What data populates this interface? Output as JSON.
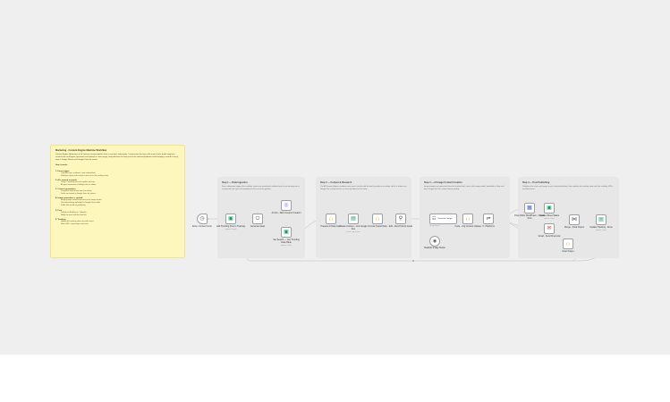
{
  "colors": {
    "canvas": "#efefef",
    "sticky": "#fdf6bd",
    "section": "#e7e7e7",
    "node_border": "#9aa0a6",
    "wire": "#b9b9b9"
  },
  "sticky": {
    "title": "Marketing · Content Engine Machine Workflow",
    "intro": "Content Engine. Automates a full content creation pipeline from a new topic submission. It researches the topic with search tools, drafts long-form content with an AI agent, generates and uploads a cover image, and publishes the final post to the selected platforms while keeping a record of every step in Google Sheets and Google Drive for review.",
    "heading": "How it works",
    "steps": [
      {
        "title": "1. Form trigger",
        "items": [
          "Captures topic, audience, tone and platform",
          "Validates inputs and creates a new row in the tracking sheet"
        ]
      },
      {
        "title": "2. AI + search research",
        "items": [
          "Tavily / Perplexity search to gather sources",
          "AI agent summarizes findings into an outline"
        ]
      },
      {
        "title": "3. Content generation",
        "items": [
          "Long-form draft written from the outline",
          "Drafts are saved as Google Docs for review"
        ]
      },
      {
        "title": "4. Image generation + upload",
        "items": [
          "Image prompt created and sent to the image model",
          "Generated image uploaded to Google Drive folder",
          "Public link stored for publishing"
        ]
      },
      {
        "title": "5. Post",
        "items": [
          "Publish to WordPress / LinkedIn",
          "Notify the team with the final link"
        ]
      },
      {
        "title": "6. Tracking",
        "items": [
          "Update the tracking sheet row with status",
          "Store URLs, timestamps and costs"
        ]
      }
    ]
  },
  "sections": [
    {
      "title": "Step 1 — Data Ingestion",
      "desc": "Form submission triggers the workflow. Inputs are normalised, validated and a new tracking row is created with the topic and metadata for the rest of the pipeline."
    },
    {
      "title": "Step 2 — Content & Research",
      "desc": "The AI Research Agent combines web search results with the brief to produce an outline, which is written to a Google Doc and passed on as structured data for the writer."
    },
    {
      "title": "Step 3 — AI Image Content Creation",
      "desc": "Image prompts are generated from the finished draft, sent to the image model, uploaded to Drive and then merged with the content before posting."
    },
    {
      "title": "Step 4 — Post Publishing",
      "desc": "Publishes the article and image to each selected platform, then updates the tracking sheet with the resulting URLs and final status."
    }
  ],
  "nodes": {
    "trigger": {
      "label": "Enter: Content Form",
      "icon": "◷"
    },
    "sheet_add": {
      "label": "Add Trending Post to Tracking",
      "sub": "append: sheet",
      "icon": "▣"
    },
    "generate": {
      "label": "Generate ideas",
      "icon": "⏻"
    },
    "research_ai": {
      "label": "AI Info - SEO Content Creation",
      "icon": "◎"
    },
    "set_row": {
      "label": "Set Search — Get Trending Data Table",
      "sub": "update: sheet",
      "icon": "▣"
    },
    "code_prepare": {
      "label": "Prepare AI Data Input",
      "icon": "{ }"
    },
    "create_doc": {
      "label": "Create Content - Link Google Doc",
      "sub": "create: document",
      "icon": "▤"
    },
    "code_format": {
      "label": "Format Output Data",
      "icon": "{ }"
    },
    "merge_image": {
      "label": "Edit - Idea Prompt Inputs",
      "icon": "⚲"
    },
    "image_agent": {
      "label": "Generate Image",
      "sub": "Image Agent",
      "icon": "☷"
    },
    "image_model": {
      "label": "Realistic Image Model",
      "icon": "◉"
    },
    "code_merge": {
      "label": "Code - Img Content Upload",
      "icon": "{ }"
    },
    "switch": {
      "label": "If - Platforms",
      "icon": "⇌"
    },
    "wordpress": {
      "label": "Post Article WordPress - Create Post",
      "icon": "▦"
    },
    "linkedin": {
      "label": "Update Sheet Status",
      "sub": "update: sheet",
      "icon": "▣"
    },
    "gmail": {
      "label": "Gmail - Send Final Link",
      "icon": "✉"
    },
    "merge_final": {
      "label": "Merge - Final Output",
      "icon": "⋈"
    },
    "final_sheet": {
      "label": "Update Tracking - Done",
      "sub": "update: sheet",
      "icon": "▤"
    },
    "done_code": {
      "label": "Final Output",
      "icon": "{ }"
    }
  }
}
